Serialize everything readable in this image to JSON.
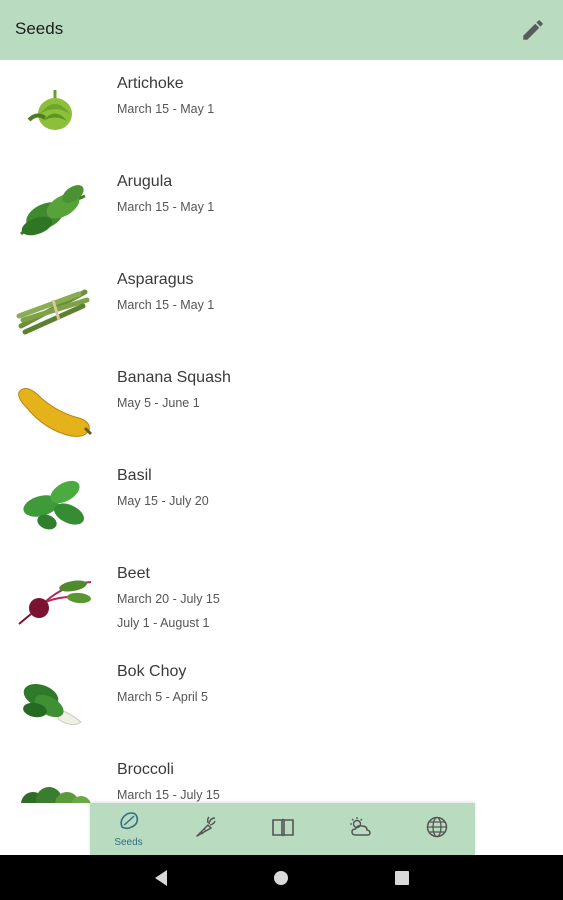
{
  "app": {
    "title": "Seeds"
  },
  "seeds": [
    {
      "name": "Artichoke",
      "dates": [
        "March 15 - May 1"
      ]
    },
    {
      "name": "Arugula",
      "dates": [
        "March 15 - May 1"
      ]
    },
    {
      "name": "Asparagus",
      "dates": [
        "March 15 - May 1"
      ]
    },
    {
      "name": "Banana Squash",
      "dates": [
        "May 5 - June 1"
      ]
    },
    {
      "name": "Basil",
      "dates": [
        "May 15 - July 20"
      ]
    },
    {
      "name": "Beet",
      "dates": [
        "March 20 - July 15",
        "July 1 - August 1"
      ]
    },
    {
      "name": "Bok Choy",
      "dates": [
        "March 5 - April 5"
      ]
    },
    {
      "name": "Broccoli",
      "dates": [
        "March 15 - July 15"
      ]
    }
  ],
  "nav": {
    "selected": "seeds",
    "items": [
      {
        "id": "seeds",
        "label": "Seeds",
        "icon": "seed-icon"
      },
      {
        "id": "plants",
        "label": "",
        "icon": "carrot-icon"
      },
      {
        "id": "guide",
        "label": "",
        "icon": "book-icon"
      },
      {
        "id": "weather",
        "label": "",
        "icon": "weather-icon"
      },
      {
        "id": "world",
        "label": "",
        "icon": "globe-icon"
      }
    ]
  },
  "system": {
    "buttons": [
      "back",
      "home",
      "recents"
    ]
  },
  "colors": {
    "app_bar": "#b9dcc0",
    "nav_accent": "#2f6d84",
    "background": "#ffffff"
  }
}
